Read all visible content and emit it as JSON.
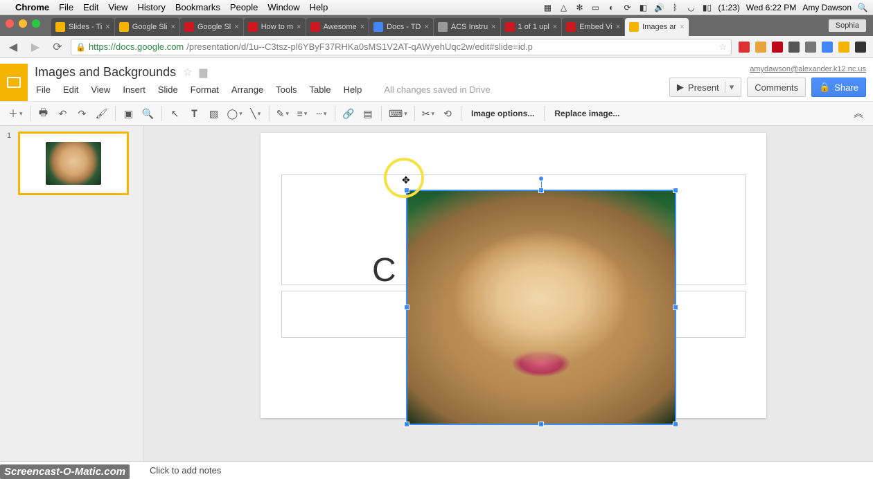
{
  "mac": {
    "app": "Chrome",
    "menus": [
      "File",
      "Edit",
      "View",
      "History",
      "Bookmarks",
      "People",
      "Window",
      "Help"
    ],
    "battery": "(1:23)",
    "clock": "Wed 6:22 PM",
    "user": "Amy Dawson"
  },
  "chrome": {
    "user_pill": "Sophia",
    "tabs": [
      {
        "label": "Slides - Ti",
        "fav": "fav-slides"
      },
      {
        "label": "Google Sli",
        "fav": "fav-slides"
      },
      {
        "label": "Google Sl",
        "fav": "fav-yt"
      },
      {
        "label": "How to m",
        "fav": "fav-yt"
      },
      {
        "label": "Awesome",
        "fav": "fav-yt"
      },
      {
        "label": "Docs - TD",
        "fav": "fav-docs"
      },
      {
        "label": "ACS Instru",
        "fav": "fav-gray"
      },
      {
        "label": "1 of 1 upl",
        "fav": "fav-yt"
      },
      {
        "label": "Embed Vi",
        "fav": "fav-yt"
      },
      {
        "label": "Images ar",
        "fav": "fav-slides",
        "active": true
      }
    ],
    "url_host": "https://docs.google.com",
    "url_path": "/presentation/d/1u--C3tsz-pl6YByF37RHKa0sMS1V2AT-qAWyehUqc2w/edit#slide=id.p"
  },
  "slides": {
    "title": "Images and Backgrounds",
    "email": "amydawson@alexander.k12.nc.us",
    "menus": [
      "File",
      "Edit",
      "View",
      "Insert",
      "Slide",
      "Format",
      "Arrange",
      "Tools",
      "Table",
      "Help"
    ],
    "saved": "All changes saved in Drive",
    "present": "Present",
    "comments": "Comments",
    "share": "Share",
    "image_options": "Image options...",
    "replace_image": "Replace image...",
    "slide_number": "1",
    "placeholder_letter": "C",
    "notes_placeholder": "Click to add notes"
  },
  "watermark": "Screencast-O-Matic.com"
}
